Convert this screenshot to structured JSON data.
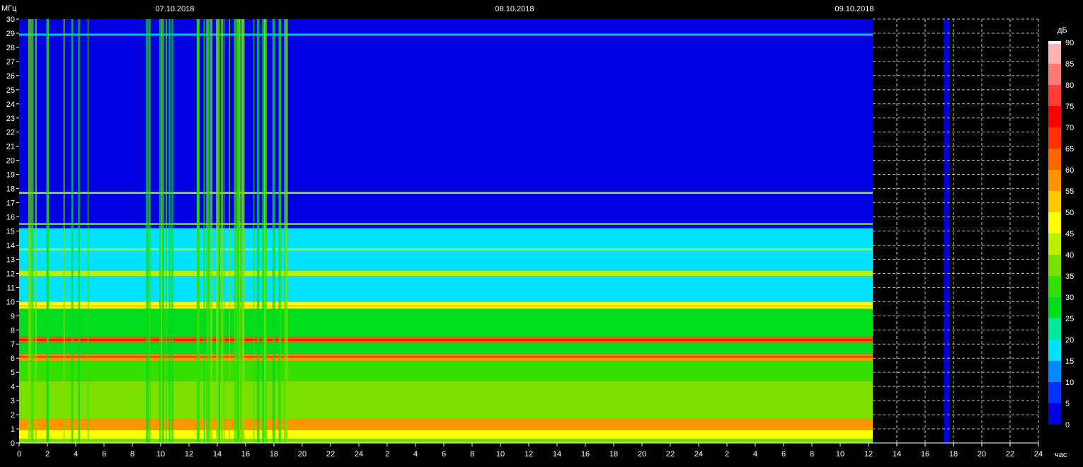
{
  "chart_data": {
    "type": "heatmap",
    "title": "",
    "ylabel": "МГц",
    "xlabel": "час",
    "colorbar_label": "дБ",
    "ylim": [
      0,
      30
    ],
    "yticks": [
      0,
      1,
      2,
      3,
      4,
      5,
      6,
      7,
      8,
      9,
      10,
      11,
      12,
      13,
      14,
      15,
      16,
      17,
      18,
      19,
      20,
      21,
      22,
      23,
      24,
      25,
      26,
      27,
      28,
      29,
      30
    ],
    "xticks": [
      "0",
      "2",
      "4",
      "6",
      "8",
      "10",
      "12",
      "14",
      "16",
      "18",
      "20",
      "22",
      "24",
      "2",
      "4",
      "6",
      "8",
      "10",
      "12",
      "14",
      "16",
      "18",
      "20",
      "22",
      "24",
      "2",
      "4",
      "6",
      "8",
      "10",
      "12",
      "14",
      "16",
      "18",
      "20",
      "22",
      "24"
    ],
    "dates": [
      "07.10.2018",
      "08.10.2018",
      "09.10.2018"
    ],
    "data_end_hour": 60.3,
    "grid": true,
    "colorbar": {
      "ticks": [
        0,
        5,
        10,
        15,
        20,
        25,
        30,
        35,
        40,
        45,
        50,
        55,
        60,
        65,
        70,
        75,
        80,
        85,
        90
      ],
      "colors": [
        "#0000e0",
        "#0033ff",
        "#0088ff",
        "#00e0ff",
        "#00e89a",
        "#00dc1e",
        "#33e000",
        "#7ae000",
        "#b8f000",
        "#ffff00",
        "#ffc800",
        "#ff9600",
        "#ff6400",
        "#ff3200",
        "#ff0000",
        "#ff3c3c",
        "#ff7878",
        "#ffb4b4",
        "#ffffff"
      ]
    },
    "bands": [
      {
        "mhz": [
          0.0,
          0.3
        ],
        "level": 35
      },
      {
        "mhz": [
          0.3,
          0.9
        ],
        "level": 45
      },
      {
        "mhz": [
          0.9,
          1.7
        ],
        "level": 55
      },
      {
        "mhz": [
          1.7,
          4.4
        ],
        "level": 35
      },
      {
        "mhz": [
          4.4,
          5.8
        ],
        "level": 30
      },
      {
        "mhz": [
          5.8,
          6.3
        ],
        "level": 55
      },
      {
        "mhz": [
          6.3,
          7.1
        ],
        "level": 25
      },
      {
        "mhz": [
          7.1,
          7.5
        ],
        "level": 60
      },
      {
        "mhz": [
          7.5,
          9.5
        ],
        "level": 25
      },
      {
        "mhz": [
          9.5,
          10.0
        ],
        "level": 45
      },
      {
        "mhz": [
          10.0,
          11.8
        ],
        "level": 15
      },
      {
        "mhz": [
          11.8,
          12.2
        ],
        "level": 40
      },
      {
        "mhz": [
          12.2,
          15.2
        ],
        "level": 15
      },
      {
        "mhz": [
          15.2,
          30.0
        ],
        "level": 0
      }
    ],
    "strong_lines_mhz": [
      {
        "mhz": 6.1,
        "level": 65
      },
      {
        "mhz": 7.3,
        "level": 70
      },
      {
        "mhz": 9.7,
        "level": 50
      },
      {
        "mhz": 13.7,
        "level": 40
      },
      {
        "mhz": 17.7,
        "level": 40
      },
      {
        "mhz": 15.5,
        "level": 35
      },
      {
        "mhz": 28.9,
        "level": 15
      }
    ],
    "broadband_intervals_hours": [
      [
        0.3,
        7.2
      ],
      [
        8.8,
        10.8
      ],
      [
        12.5,
        19.0
      ]
    ],
    "gap_hour": 65.3
  }
}
